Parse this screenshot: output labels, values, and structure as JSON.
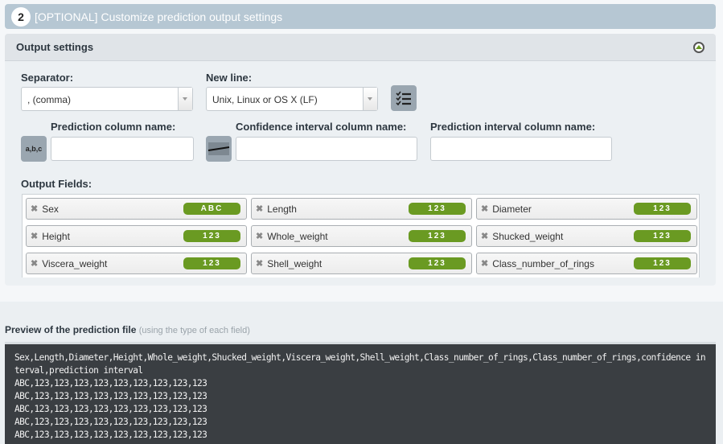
{
  "step": {
    "number": "2",
    "title": "[OPTIONAL] Customize prediction output settings"
  },
  "panel": {
    "title": "Output settings",
    "separator": {
      "label": "Separator:",
      "value": ", (comma)"
    },
    "newline": {
      "label": "New line:",
      "value": "Unix, Linux or OS X (LF)"
    },
    "prediction_col": {
      "label": "Prediction column name:",
      "value": ""
    },
    "confidence_col": {
      "label": "Confidence interval column name:",
      "value": ""
    },
    "interval_col": {
      "label": "Prediction interval column name:",
      "value": ""
    },
    "icons": {
      "fields_list": "checklist-icon",
      "prediction": "abc-format-icon",
      "confidence": "interval-icon"
    },
    "separator_icon_text": "a,b,c",
    "output_fields_label": "Output Fields:",
    "fields": [
      {
        "name": "Sex",
        "type": "ABC"
      },
      {
        "name": "Length",
        "type": "123"
      },
      {
        "name": "Diameter",
        "type": "123"
      },
      {
        "name": "Height",
        "type": "123"
      },
      {
        "name": "Whole_weight",
        "type": "123"
      },
      {
        "name": "Shucked_weight",
        "type": "123"
      },
      {
        "name": "Viscera_weight",
        "type": "123"
      },
      {
        "name": "Shell_weight",
        "type": "123"
      },
      {
        "name": "Class_number_of_rings",
        "type": "123"
      }
    ]
  },
  "preview": {
    "label": "Preview of the prediction file",
    "note": "(using the type of each field)",
    "lines": [
      "Sex,Length,Diameter,Height,Whole_weight,Shucked_weight,Viscera_weight,Shell_weight,Class_number_of_rings,Class_number_of_rings,confidence interval,prediction interval",
      "ABC,123,123,123,123,123,123,123,123,123",
      "ABC,123,123,123,123,123,123,123,123,123",
      "ABC,123,123,123,123,123,123,123,123,123",
      "ABC,123,123,123,123,123,123,123,123,123",
      "ABC,123,123,123,123,123,123,123,123,123"
    ]
  },
  "colors": {
    "badge": "#6a9a22",
    "header": "#b6c7d3",
    "code_bg": "#3a3e42"
  }
}
